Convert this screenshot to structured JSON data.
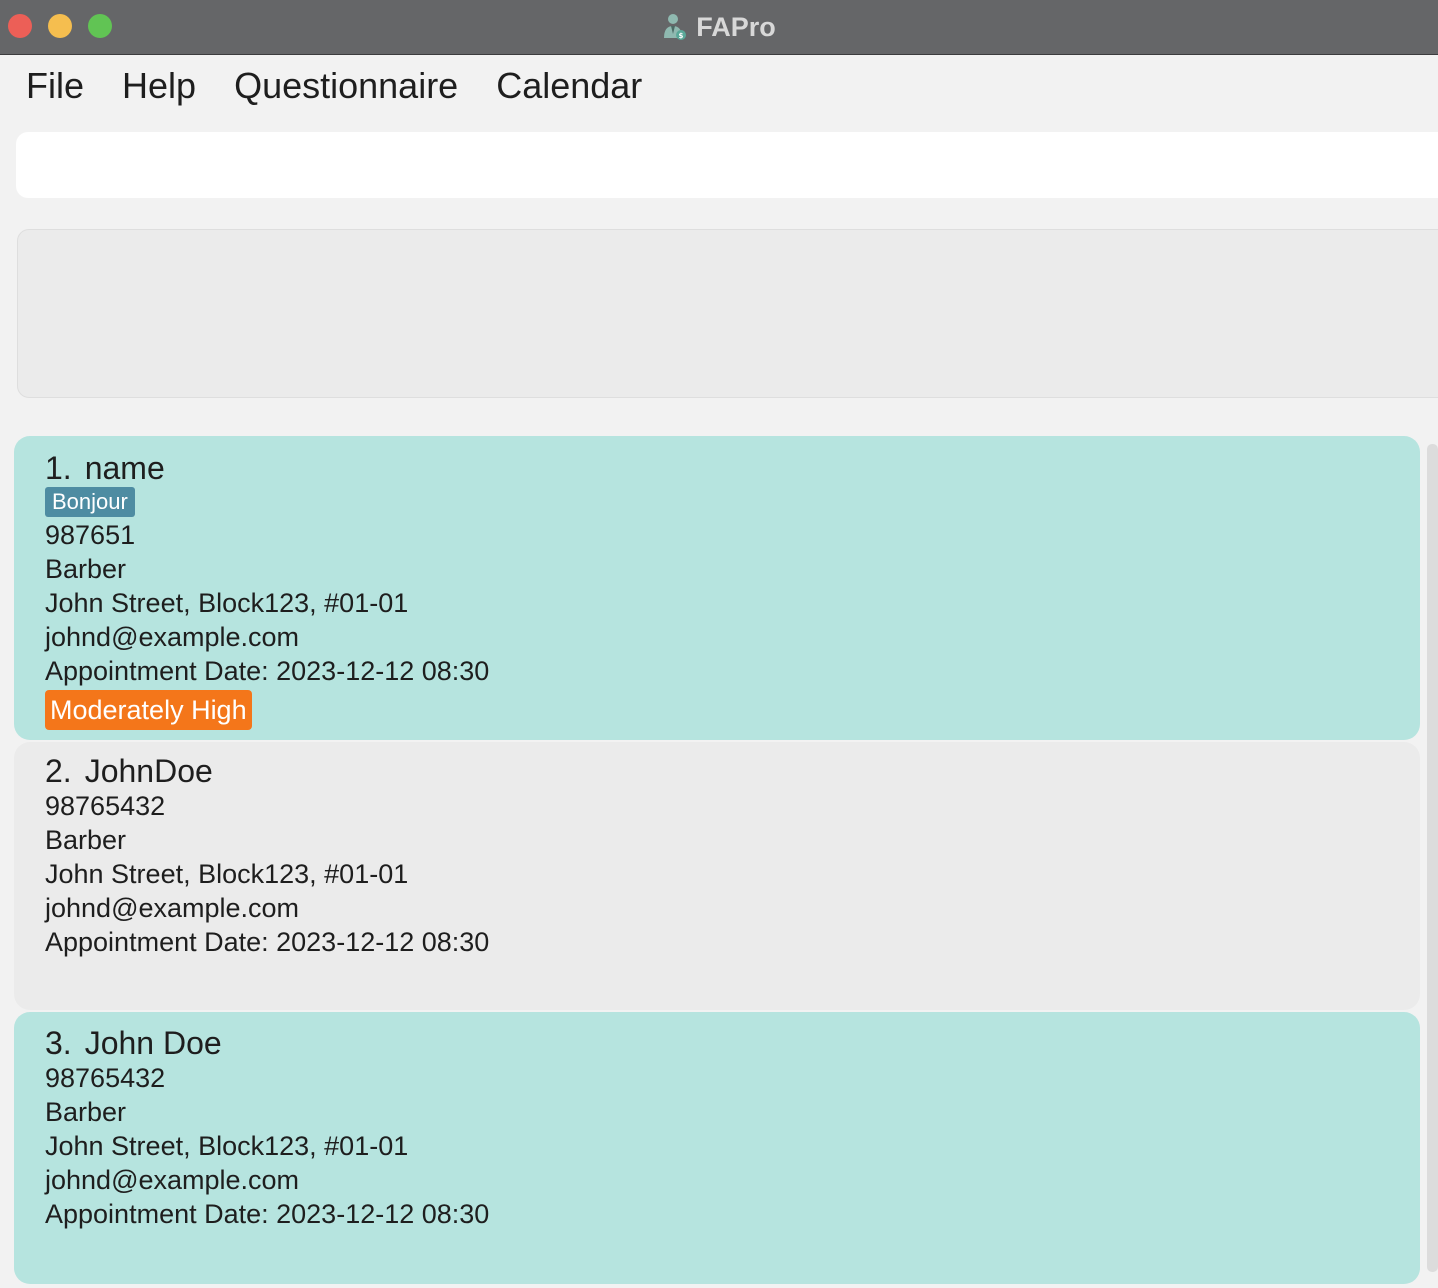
{
  "window": {
    "title": "FAPro"
  },
  "menu": {
    "file": "File",
    "help": "Help",
    "questionnaire": "Questionnaire",
    "calendar": "Calendar"
  },
  "command": {
    "value": "",
    "placeholder": ""
  },
  "result": {
    "text": ""
  },
  "colors": {
    "teal_card": "#b6e4df",
    "grey_card": "#ebebeb",
    "tag": "#4e8ca2",
    "risk_moderately_high": "#f4761a"
  },
  "persons": [
    {
      "index": "1.",
      "name": "name",
      "tag": "Bonjour",
      "phone": "987651",
      "occupation": "Barber",
      "address": "John Street, Block123, #01-01",
      "email": "johnd@example.com",
      "appointment": "Appointment Date: 2023-12-12 08:30",
      "risk": "Moderately High"
    },
    {
      "index": "2.",
      "name": "JohnDoe",
      "phone": "98765432",
      "occupation": "Barber",
      "address": "John Street, Block123, #01-01",
      "email": "johnd@example.com",
      "appointment": "Appointment Date: 2023-12-12 08:30"
    },
    {
      "index": "3.",
      "name": "John Doe",
      "phone": "98765432",
      "occupation": "Barber",
      "address": "John Street, Block123, #01-01",
      "email": "johnd@example.com",
      "appointment": "Appointment Date: 2023-12-12 08:30"
    }
  ]
}
